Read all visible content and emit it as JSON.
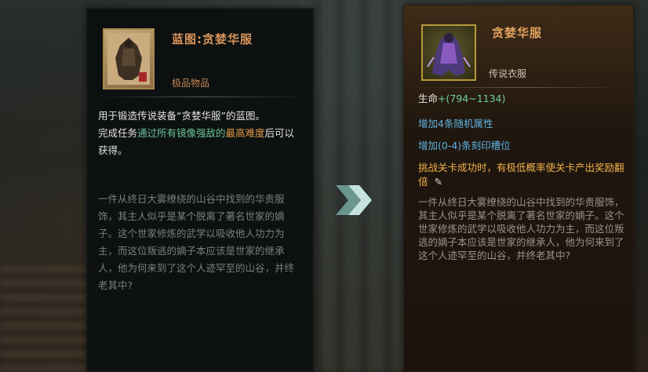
{
  "left": {
    "title": "蓝图:贪婪华服",
    "quality": "极品物品",
    "desc": "用于锻造传说装备“贪婪华服”的蓝图。",
    "quest_prefix": "完成任务",
    "quest_green": "通过所有镜像强敌的",
    "quest_orange": "最高难度",
    "quest_suffix": "后可以获得。",
    "lore": "一件从终日大雾缭绕的山谷中找到的华贵服饰，其主人似乎是某个脱离了著名世家的嫡子。这个世家修炼的武学以吸收他人功力为主，而这位叛逃的嫡子本应该是世家的继承人，他为何来到了这个人迹罕至的山谷，并终老其中?",
    "icon": "blueprint-armor-icon"
  },
  "arrow_icon": "double-chevron-right-icon",
  "right": {
    "title": "贪婪华服",
    "type": "传说衣服",
    "stat_label": "生命",
    "stat_range": "+(794~1134)",
    "affix1": "增加4条随机属性",
    "affix2": "增加(0-4)条刻印槽位",
    "bonus": "挑战关卡成功时，有极低概率使关卡产出奖励翻倍",
    "pencil": "✎",
    "lore": "一件从终日大雾缭绕的山谷中找到的华贵服饰，其主人似乎是某个脱离了著名世家的嫡子。这个世家修炼的武学以吸收他人功力为主，而这位叛逃的嫡子本应该是世家的继承人，他为何来到了这个人迹罕至的山谷，并终老其中?",
    "icon": "legendary-robe-icon"
  },
  "colors": {
    "title": "#d9955a",
    "green": "#6bc29a",
    "orange": "#e39a4a",
    "blue": "#5eb3e0",
    "gold": "#f2b24c"
  }
}
